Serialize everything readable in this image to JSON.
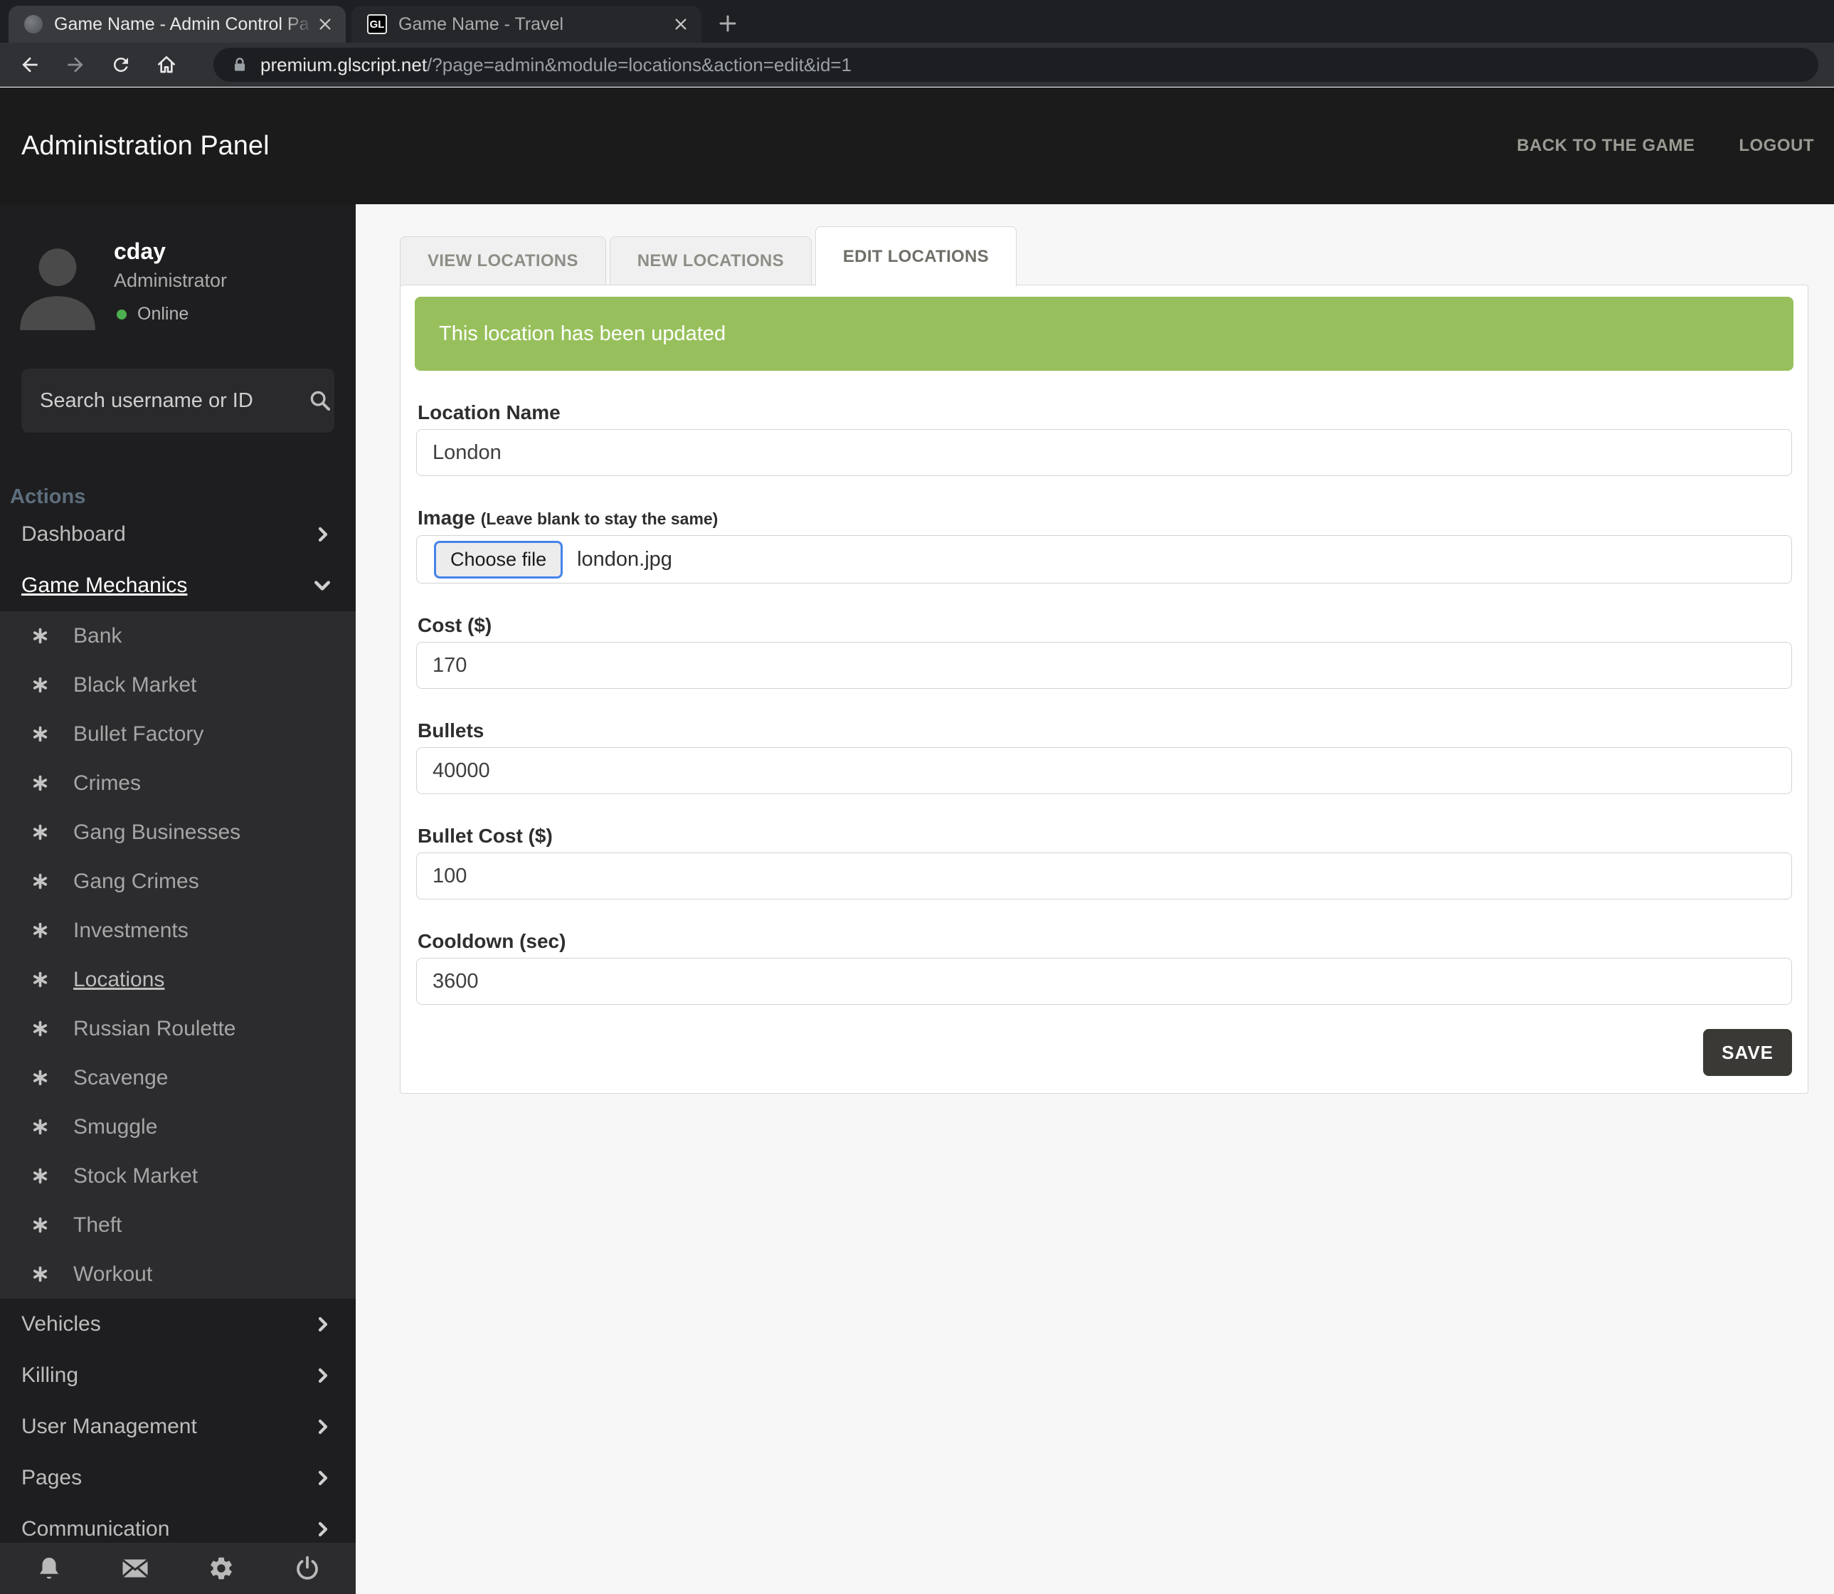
{
  "browser": {
    "tabs": [
      {
        "title": "Game Name - Admin Control Pa",
        "favicon": "globe-icon"
      },
      {
        "title": "Game Name - Travel",
        "favicon_text": "GL",
        "favicon": "gl-logo"
      }
    ],
    "url": {
      "domain": "premium.glscript.net",
      "path": "/?page=admin&module=locations&action=edit&id=1"
    }
  },
  "header": {
    "title": "Administration Panel",
    "back_to_game_label": "BACK TO THE GAME",
    "logout_label": "LOGOUT"
  },
  "sidebar": {
    "user": {
      "name": "cday",
      "role": "Administrator",
      "status": "Online"
    },
    "search_placeholder": "Search username or ID",
    "section_label": "Actions",
    "menu_top": {
      "dashboard": "Dashboard",
      "game_mechanics": "Game Mechanics"
    },
    "submenu": [
      "Bank",
      "Black Market",
      "Bullet Factory",
      "Crimes",
      "Gang Businesses",
      "Gang Crimes",
      "Investments",
      "Locations",
      "Russian Roulette",
      "Scavenge",
      "Smuggle",
      "Stock Market",
      "Theft",
      "Workout"
    ],
    "active_submenu": "Locations",
    "menu_bottom": [
      "Vehicles",
      "Killing",
      "User Management",
      "Pages",
      "Communication"
    ]
  },
  "main": {
    "tabs": [
      {
        "label": "VIEW LOCATIONS"
      },
      {
        "label": "NEW LOCATIONS"
      },
      {
        "label": "EDIT LOCATIONS",
        "active": true
      }
    ],
    "alert": "This location has been updated",
    "form": {
      "fields": [
        {
          "label": "Location Name",
          "value": "London"
        },
        {
          "label": "Image",
          "hint": "(Leave blank to stay the same)",
          "button": "Choose file",
          "filename": "london.jpg"
        },
        {
          "label": "Cost ($)",
          "value": "170"
        },
        {
          "label": "Bullets",
          "value": "40000"
        },
        {
          "label": "Bullet Cost ($)",
          "value": "100"
        },
        {
          "label": "Cooldown (sec)",
          "value": "3600"
        }
      ],
      "save_label": "SAVE"
    }
  },
  "colors": {
    "alert_green": "#97c05c",
    "online_green": "#4caf50",
    "choose_file_focus_blue": "#4683ea",
    "save_button_bg": "#3b3935"
  }
}
